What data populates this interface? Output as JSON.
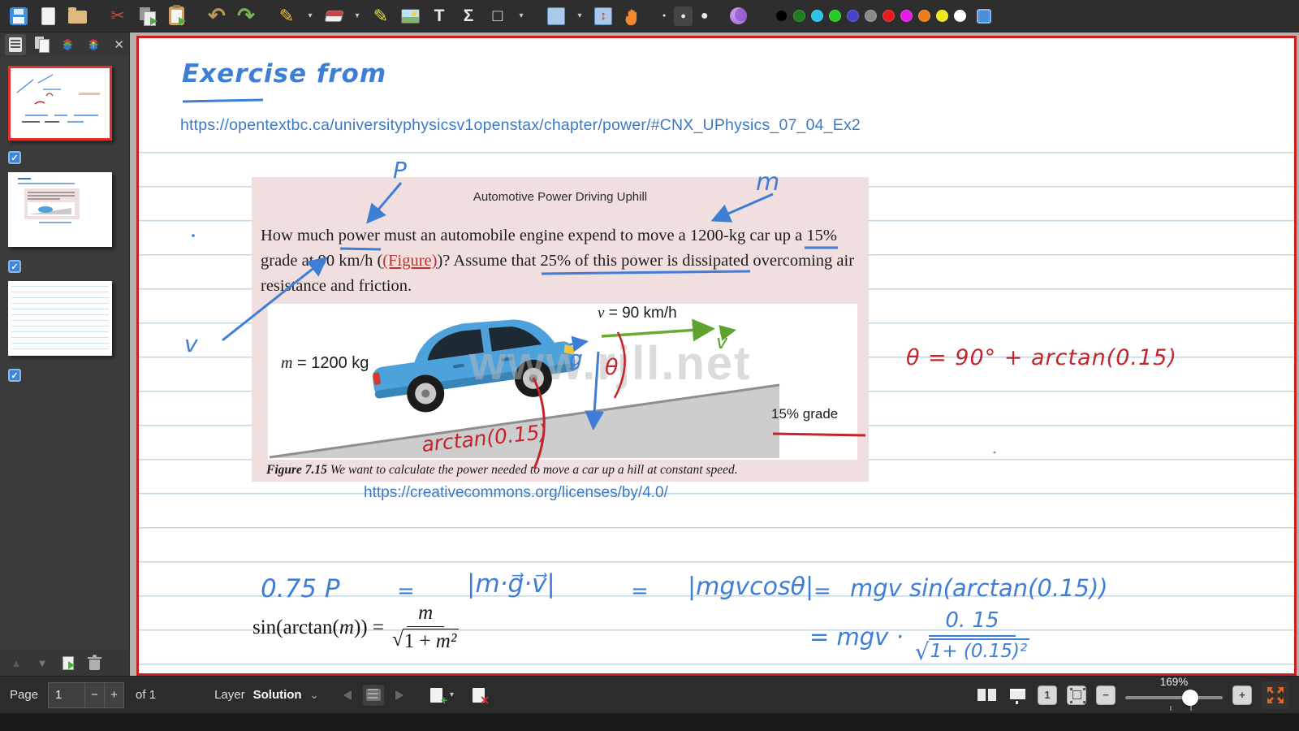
{
  "glyphs": {
    "dropdown": "▾",
    "chevron": "⌄",
    "text_tool": "T",
    "math_tool": "Σ",
    "shape_tool": "□",
    "scissors": "✂",
    "undo": "↶",
    "redo": "↷",
    "pen": "✎",
    "highlighter": "✎",
    "vspace": "↕",
    "close": "✕",
    "up": "▲",
    "down": "▼",
    "minus": "−",
    "plus": "+",
    "check": "✓",
    "dot": "●",
    "diamond": "◆",
    "up_arrow": "↑",
    "one": "1"
  },
  "colors": {
    "palette": [
      "#000000",
      "#1e7d1e",
      "#2bc3e8",
      "#25cc25",
      "#4444c8",
      "#8a8a8a",
      "#e81a1a",
      "#e81ae8",
      "#ef7d1d",
      "#efe81d",
      "#ffffff"
    ],
    "custom_swatch": "#4a8fd8"
  },
  "statusbar": {
    "page_label": "Page",
    "page_value": "1",
    "of_label": "of 1",
    "layer_label": "Layer",
    "layer_value": "Solution",
    "zoom_value": "169%"
  },
  "canvas": {
    "heading": "Exercise from",
    "source_url": "https://opentextbc.ca/universityphysicsv1openstax/chapter/power/#CNX_UPhysics_07_04_Ex2",
    "cc_url": "https://creativecommons.org/licenses/by/4.0/",
    "exercise": {
      "title": "Automotive Power Driving Uphill",
      "body": {
        "s1": "How much ",
        "s2": "power",
        "s3": " must an automobile engine expend to move a 1200-kg car up a ",
        "s4": "15%",
        "s5": "grade at 90 km/h (",
        "s6": "(Figure)",
        "s7": ")? Assume that ",
        "s8": "25% of this power is dissipated",
        "s9a": " overcoming air",
        "s9b": "resistance and friction."
      },
      "figure": {
        "mass_var": "m",
        "mass_rest": " = 1200 kg",
        "speed_var": "v",
        "speed_rest": " = 90 km/h",
        "grade": "15% grade",
        "watermark": "www.rjll.net",
        "caption_label": "Figure 7.15",
        "caption_text": " We want to calculate the power needed to move a car up a hill at constant speed."
      }
    },
    "annotations": {
      "p": "P",
      "m": "m",
      "v": "v",
      "g": "g",
      "v2": "v",
      "theta": "θ",
      "arctan": "arctan(0.15)",
      "eq_red": "θ = 90° + arctan(0.15)",
      "eq1": {
        "a": "0.75 P",
        "eq": "=",
        "b": "|m·g⃗·v⃗|",
        "c": "|mgvcosθ|",
        "d": "mgv sin(arctan(0.15))"
      },
      "latex": {
        "lhs1": "sin(arctan(",
        "var": "m",
        "lhs2": ")) =",
        "num": "m",
        "sqrt": "√",
        "den1": "1 + ",
        "den2": "m²"
      },
      "eq2": {
        "lhs": "= mgv ·",
        "num": "0. 15",
        "sqrt": "√",
        "den": "1+ (0.15)²"
      }
    }
  }
}
